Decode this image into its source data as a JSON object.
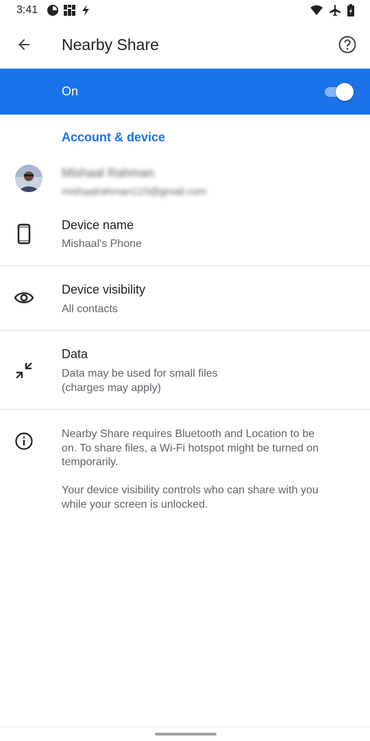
{
  "status_bar": {
    "time": "3:41",
    "left_icons": [
      "pie-chart-icon",
      "grid-app-icon",
      "bolt-icon"
    ],
    "right_icons": [
      "wifi-icon",
      "airplane-icon",
      "battery-icon"
    ]
  },
  "app_bar": {
    "title": "Nearby Share",
    "back_icon": "arrow-back-icon",
    "help_icon": "help-circle-icon"
  },
  "master_switch": {
    "label": "On",
    "state": true,
    "color": "#1a73e8"
  },
  "account_section": {
    "header": "Account & device",
    "account_name": "Mishaal Rahman",
    "account_email": "mishaalrahman123@gmail.com",
    "device_name_title": "Device name",
    "device_name_value": "Mishaal's Phone"
  },
  "visibility": {
    "title": "Device visibility",
    "value": "All contacts"
  },
  "data_usage": {
    "title": "Data",
    "line1": "Data may be used for small files",
    "line2": "(charges may apply)"
  },
  "info": {
    "line1": "Nearby Share requires Bluetooth and Location to be",
    "line2": "on. To share files, a Wi-Fi hotspot might be turned on",
    "line3": "temporarily.",
    "line4": "Your device visibility controls who can share with you",
    "line5": "while your screen is unlocked."
  },
  "colors": {
    "accent": "#1a73e8",
    "text_primary": "#202124",
    "text_secondary": "#5f6368"
  }
}
